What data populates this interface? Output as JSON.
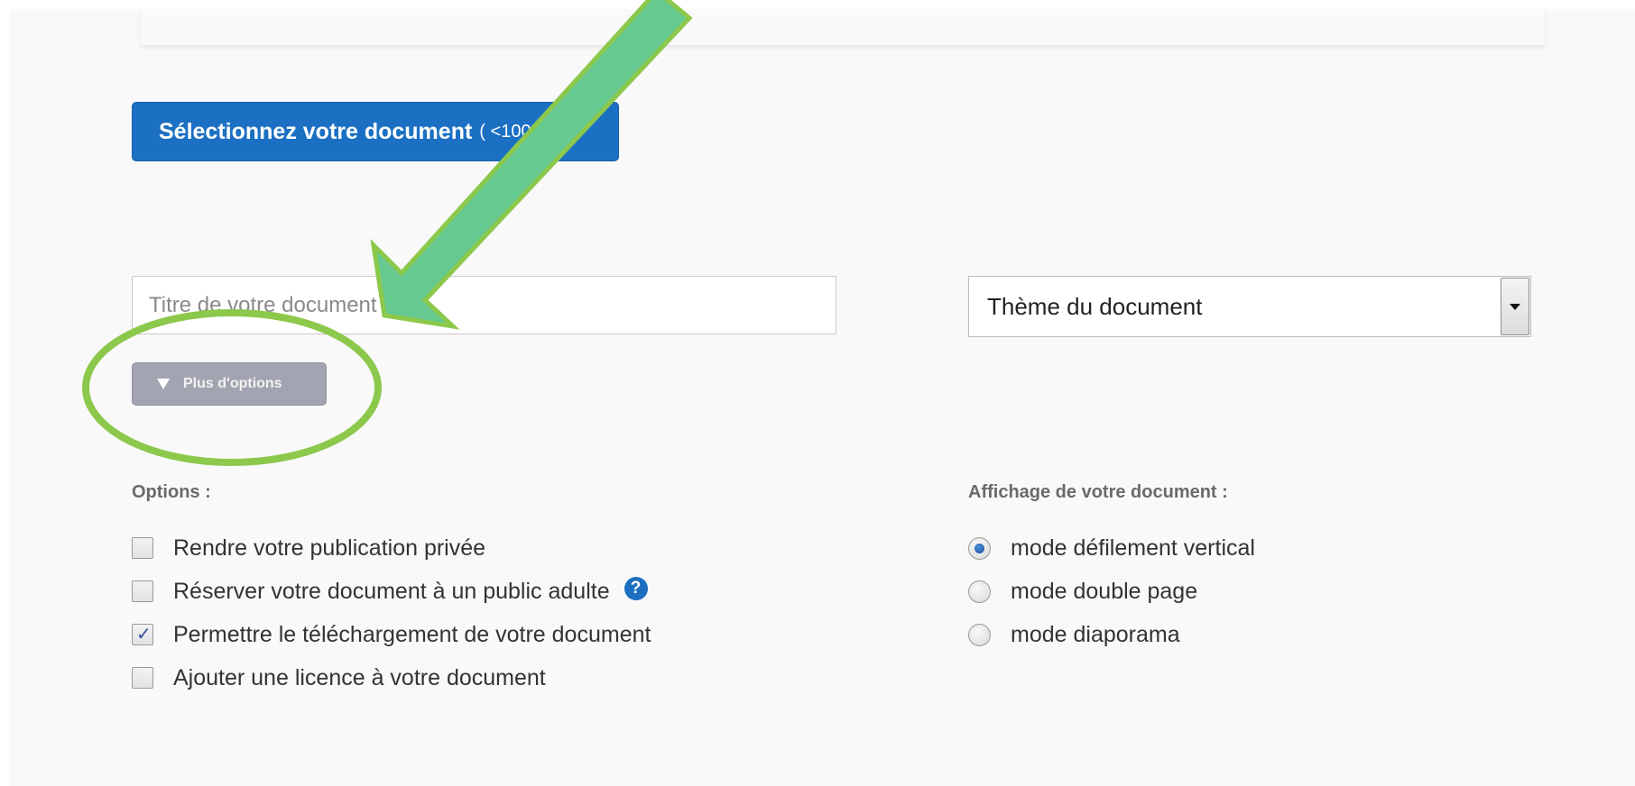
{
  "upload": {
    "button_label": "Sélectionnez votre document",
    "size_hint": "( <100Mo )"
  },
  "form": {
    "title_placeholder": "Titre de votre document",
    "theme_select_value": "Thème du document",
    "more_options_label": "Plus d'options"
  },
  "options": {
    "heading": "Options :",
    "items": [
      {
        "label": "Rendre votre publication privée",
        "checked": false
      },
      {
        "label": "Réserver votre document à un public adulte",
        "checked": false,
        "help_icon": "question-circle-icon"
      },
      {
        "label": "Permettre le téléchargement de votre document",
        "checked": true
      },
      {
        "label": "Ajouter une licence à votre document",
        "checked": false
      }
    ]
  },
  "display": {
    "heading": "Affichage de votre document :",
    "modes": [
      {
        "label": "mode défilement vertical",
        "selected": true
      },
      {
        "label": "mode double page",
        "selected": false
      },
      {
        "label": "mode diaporama",
        "selected": false
      }
    ]
  },
  "annotations": {
    "arrow_color": "#66c98f",
    "arrow_outline_color": "#8cc84b",
    "ellipse_color": "#8cc84b"
  },
  "colors": {
    "primary_button": "#1c70c3",
    "secondary_button": "#a3a4b1",
    "help_icon": "#1c6fc0"
  }
}
